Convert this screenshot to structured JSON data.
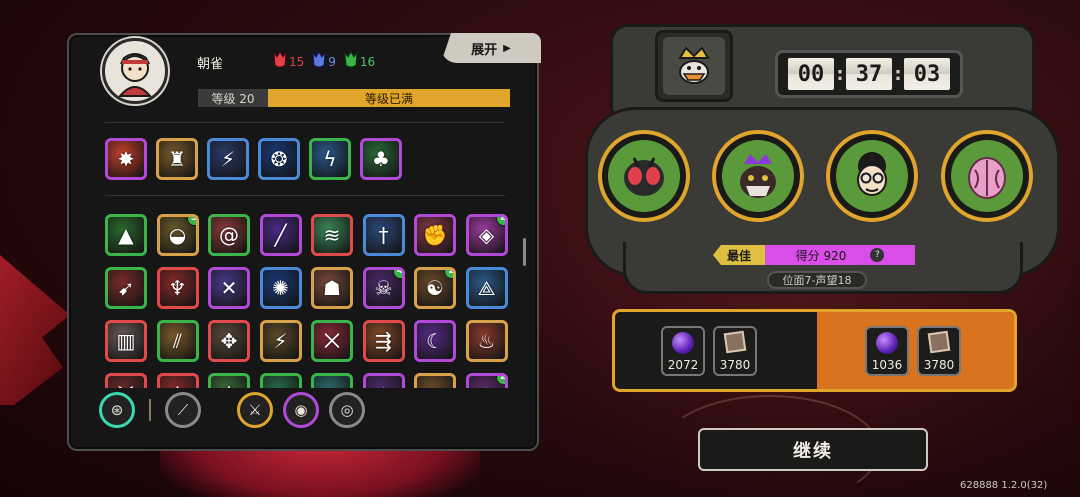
{
  "player": {
    "name": "朝雀",
    "currencies": [
      {
        "icon": "red-mask-icon",
        "color": "#e0404a",
        "value": "15"
      },
      {
        "icon": "blue-mask-icon",
        "color": "#5a7ae0",
        "value": "9"
      },
      {
        "icon": "green-mask-icon",
        "color": "#3bb54a",
        "value": "16"
      }
    ],
    "level_label": "等级 20",
    "level_status": "等级已满"
  },
  "expand_label": "展开",
  "abilities": [
    {
      "icon": "burst-icon",
      "glyph": "✸",
      "border": "#b24ad8",
      "bg": "#c8402a"
    },
    {
      "icon": "shield-warrior-icon",
      "glyph": "♜",
      "border": "#d8a24a",
      "bg": "#7a5a2a"
    },
    {
      "icon": "lightning-cross-icon",
      "glyph": "⚡",
      "border": "#4a8ad8",
      "bg": "#2a3a6a"
    },
    {
      "icon": "energy-orb-icon",
      "glyph": "❂",
      "border": "#4a8ad8",
      "bg": "#1a3a7a"
    },
    {
      "icon": "storm-icon",
      "glyph": "ϟ",
      "border": "#3bb54a",
      "bg": "#2a5a8a"
    },
    {
      "icon": "green-spirit-icon",
      "glyph": "♣",
      "border": "#b24ad8",
      "bg": "#2a6a3a"
    }
  ],
  "relics": [
    {
      "icon": "green-blade-icon",
      "glyph": "▲",
      "border": "#3bb54a",
      "bg": "#2a6a2a"
    },
    {
      "icon": "sunrise-icon",
      "glyph": "◒",
      "border": "#d8a24a",
      "bg": "#6a5a2a",
      "badge": "5"
    },
    {
      "icon": "spiral-icon",
      "glyph": "@",
      "border": "#3bb54a",
      "bg": "#8a3a3a"
    },
    {
      "icon": "purple-slash-icon",
      "glyph": "╱",
      "border": "#b24ad8",
      "bg": "#4a2a8a"
    },
    {
      "icon": "wind-icon",
      "glyph": "≋",
      "border": "#e04a4a",
      "bg": "#3a8a5a"
    },
    {
      "icon": "dagger-icon",
      "glyph": "†",
      "border": "#4a8ad8",
      "bg": "#2a4a7a"
    },
    {
      "icon": "fist-icon",
      "glyph": "✊",
      "border": "#b24ad8",
      "bg": "#8a3a4a"
    },
    {
      "icon": "purple-gem-icon",
      "glyph": "◈",
      "border": "#b24ad8",
      "bg": "#a03aa0",
      "badge": "2"
    },
    {
      "icon": "arrow-burst-icon",
      "glyph": "➹",
      "border": "#3bb54a",
      "bg": "#7a2a2a"
    },
    {
      "icon": "demon-figure-icon",
      "glyph": "♆",
      "border": "#e04a4a",
      "bg": "#8a2a2a"
    },
    {
      "icon": "crossed-blades-icon",
      "glyph": "✕",
      "border": "#b24ad8",
      "bg": "#4a3a8a"
    },
    {
      "icon": "electric-orb-icon",
      "glyph": "✺",
      "border": "#4a8ad8",
      "bg": "#1a3a7a"
    },
    {
      "icon": "rock-golem-icon",
      "glyph": "☗",
      "border": "#d8a24a",
      "bg": "#7a4a3a"
    },
    {
      "icon": "shadow-beast-icon",
      "glyph": "☠",
      "border": "#b24ad8",
      "bg": "#4a2a6a",
      "badge": "4"
    },
    {
      "icon": "chain-icon",
      "glyph": "☯",
      "border": "#d8a24a",
      "bg": "#6a4a2a",
      "badge": "2"
    },
    {
      "icon": "spike-icon",
      "glyph": "⟁",
      "border": "#4a8ad8",
      "bg": "#2a5a8a"
    },
    {
      "icon": "pillar-icon",
      "glyph": "▥",
      "border": "#e04a4a",
      "bg": "#6a5a5a"
    },
    {
      "icon": "claws-icon",
      "glyph": "⫽",
      "border": "#3bb54a",
      "bg": "#7a5a2a"
    },
    {
      "icon": "compass-icon",
      "glyph": "✥",
      "border": "#e04a4a",
      "bg": "#5a4a3a"
    },
    {
      "icon": "lightning-strike-icon",
      "glyph": "⚡",
      "border": "#d8a24a",
      "bg": "#5a4a2a"
    },
    {
      "icon": "red-fang-icon",
      "glyph": "⨉",
      "border": "#3bb54a",
      "bg": "#8a2a3a"
    },
    {
      "icon": "fire-arrows-icon",
      "glyph": "⇶",
      "border": "#e04a4a",
      "bg": "#8a4a2a"
    },
    {
      "icon": "moon-orb-icon",
      "glyph": "☾",
      "border": "#b24ad8",
      "bg": "#5a2a8a"
    },
    {
      "icon": "flame-icon",
      "glyph": "♨",
      "border": "#d8a24a",
      "bg": "#8a3a2a"
    },
    {
      "icon": "horned-skull-icon",
      "glyph": "♉",
      "border": "#e04a4a",
      "bg": "#6a2a2a"
    },
    {
      "icon": "red-claw-icon",
      "glyph": "⋔",
      "border": "#e04a4a",
      "bg": "#8a2a2a"
    },
    {
      "icon": "green-claw-icon",
      "glyph": "⋔",
      "border": "#3bb54a",
      "bg": "#3a6a3a"
    },
    {
      "icon": "green-wave-icon",
      "glyph": "≈",
      "border": "#3bb54a",
      "bg": "#2a6a4a"
    },
    {
      "icon": "teal-wave-icon",
      "glyph": "≈",
      "border": "#3bb54a",
      "bg": "#2a6a6a"
    },
    {
      "icon": "purple-rune-icon",
      "glyph": "✦",
      "border": "#b24ad8",
      "bg": "#4a2a6a"
    },
    {
      "icon": "brown-scroll-icon",
      "glyph": "≡",
      "border": "#d8a24a",
      "bg": "#6a4a2a"
    },
    {
      "icon": "purple-mark-icon",
      "glyph": "✧",
      "border": "#b24ad8",
      "bg": "#5a2a6a",
      "badge": "2"
    }
  ],
  "equipment": [
    {
      "icon": "wheel-icon",
      "glyph": "⊛",
      "border": "#3bd8b0"
    },
    {
      "icon": "feather-blade-icon",
      "glyph": "⟋",
      "border": "#8a8a8a"
    },
    {
      "icon": "crossed-swords-icon",
      "glyph": "⚔",
      "border": "#e0a52a"
    },
    {
      "icon": "green-orb-icon",
      "glyph": "◉",
      "border": "#b24ad8"
    },
    {
      "icon": "silver-ring-icon",
      "glyph": "◎",
      "border": "#8a8a8a"
    }
  ],
  "timer": {
    "h": "00",
    "m": "37",
    "s": "03"
  },
  "bosses": [
    {
      "icon": "fly-monster-icon",
      "glyph": "🪰"
    },
    {
      "icon": "crowned-beast-icon",
      "glyph": "👹"
    },
    {
      "icon": "glasses-kid-icon",
      "glyph": "🤓"
    },
    {
      "icon": "pink-flower-monster-icon",
      "glyph": "🌸"
    }
  ],
  "best_label": "最佳",
  "score_label": "得分 920",
  "plane_label": "位面7-声望18",
  "rewards": {
    "current": [
      {
        "icon": "purple-orb-icon",
        "value": "2072"
      },
      {
        "icon": "card-icon",
        "value": "3780"
      }
    ],
    "total": [
      {
        "icon": "purple-orb-up-icon",
        "value": "1036"
      },
      {
        "icon": "card-up-icon",
        "value": "3780"
      }
    ]
  },
  "continue_label": "继续",
  "version": "628888 1.2.0(32)"
}
